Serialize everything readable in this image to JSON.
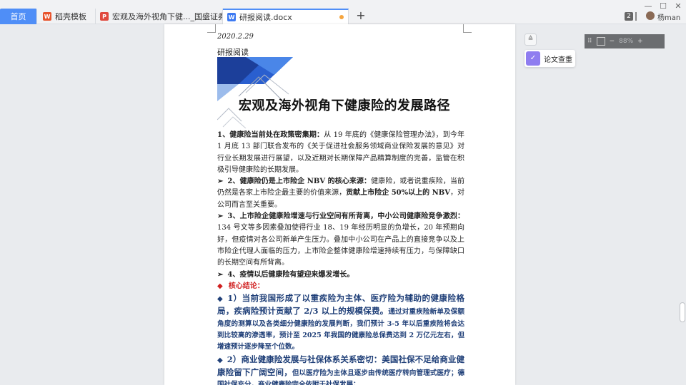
{
  "tabs": {
    "home": "首页",
    "items": [
      {
        "label": "稻壳模板",
        "icon": "wps-icon"
      },
      {
        "label": "宏观及海外视角下健..._国盛证券.pdf",
        "icon": "pdf-icon"
      },
      {
        "label": "研报阅读.docx",
        "icon": "doc-icon"
      }
    ],
    "add": "+"
  },
  "window": {
    "minimize": "—",
    "maximize": "☐",
    "close": "✕"
  },
  "user": {
    "badge": "2",
    "name": "杨man"
  },
  "doc": {
    "date": "2020.2.29",
    "subtitle": "研报阅读",
    "title": "宏观及海外视角下健康险的发展路径",
    "p1_head": "1、健康险当前处在政策密集期：",
    "p1_body": "从 19 年底的《健康保险管理办法》，到今年 1 月底 13 部门联合发布的《关于促进社会服务领域商业保险发展的意见》对行业长期发展进行展望，以及近期对长期保障产品精算制度的完善，监管在积极引导健康险的长期发展。",
    "p2_arrow": "➢",
    "p2_head": "2、健康险仍是上市险企 NBV 的核心来源：",
    "p2_body": "健康险，或者说重疾险，当前仍然是各家上市险企最主要的价值来源，",
    "p2_bold": "贡献上市险企 50%以上的 NBV",
    "p2_tail": "，对公司而言至关重要。",
    "p3_arrow": "➢",
    "p3_head": "3、上市险企健康险增速与行业空间有所背离，中小公司健康险竞争激烈：",
    "p3_body": "134 号文等多因素叠加使得行业 18、19 年经历明显的负增长，20 年预期向好，但疫情对各公司新单产生压力。叠加中小公司在产品上的直接竞争以及上市险企代理人面临的压力，上市险企整体健康险增速持续有压力，与保障缺口的长期空间有所背离。",
    "p4_arrow": "➢",
    "p4_head": "4、疫情以后健康险有望迎来爆发增长。",
    "p5_dia": "◆",
    "p5_head": "核心结论：",
    "p6_dia": "◆",
    "p6_big": "1）当前我国形成了以重疾险为主体、医疗险为辅助的健康险格局，疾病险预计贡献了 2/3 以上的规模保费。",
    "p6_small": "通过对重疾险新单及保额角度的测算以及各类细分健康险的发展判断，我们预计 3-5 年以后重疾险将会达到比较高的渗透率，预计至 2025 年我国的健康险总保费达到 2 万亿元左右，但增速预计逐步降至个位数。",
    "p7_dia": "◆",
    "p7_big": "2）商业健康险发展与社保体系关系密切：美国社保不足给商业健康险留下广阔空间，",
    "p7_small": "但以医疗险为主体且逐步由传统医疗转向管理式医疗；德国社保充分，商业健康险完全依附于社保发展；"
  },
  "sidebar": {
    "collapse": "≙",
    "check_label": "论文查重"
  },
  "zoom": {
    "value": "88%"
  }
}
